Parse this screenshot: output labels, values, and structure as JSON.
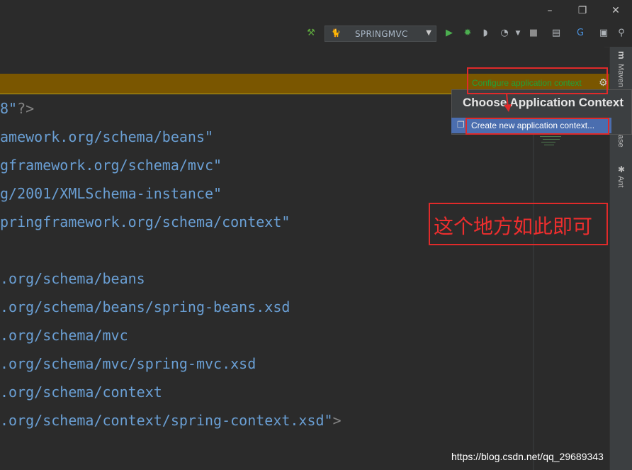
{
  "window": {
    "minimize_glyph": "–",
    "restore_glyph": "❐",
    "close_glyph": "✕"
  },
  "toolbar": {
    "run_config": {
      "label": "SPRINGMVC"
    },
    "icons": [
      "hammer-icon",
      "run-icon",
      "debug-icon",
      "coverage-icon",
      "profiler-icon",
      "stop-icon",
      "project-structure-icon",
      "translate-icon",
      "terminal-icon",
      "search-icon"
    ]
  },
  "editor": {
    "banner": {
      "link_label": "Configure application context"
    },
    "code_lines": [
      {
        "text": "8\"",
        "tail": "?>"
      },
      {
        "text": "amework.org/schema/beans\"",
        "tail": ""
      },
      {
        "text": "gframework.org/schema/mvc\"",
        "tail": ""
      },
      {
        "text": "g/2001/XMLSchema-instance\"",
        "tail": ""
      },
      {
        "text": "pringframework.org/schema/context\"",
        "tail": ""
      },
      {
        "text": "",
        "tail": ""
      },
      {
        "text": ".org/schema/beans",
        "tail": ""
      },
      {
        "text": ".org/schema/beans/spring-beans.xsd",
        "tail": ""
      },
      {
        "text": ".org/schema/mvc",
        "tail": ""
      },
      {
        "text": ".org/schema/mvc/spring-mvc.xsd",
        "tail": ""
      },
      {
        "text": ".org/schema/context",
        "tail": ""
      },
      {
        "text": ".org/schema/context/spring-context.xsd\"",
        "tail": ">"
      }
    ]
  },
  "popup": {
    "title": "Choose Application Context",
    "item_label": "Create new application context..."
  },
  "side_tabs": {
    "maven": "Maven",
    "database": "ase",
    "ant": "Ant"
  },
  "annotation": {
    "text": "这个地方如此即可",
    "color": "#e02a2a"
  },
  "watermark": "https://blog.csdn.net/qq_29689343",
  "colors": {
    "background": "#2b2b2b",
    "banner": "#7a5600",
    "link": "#1ea33c",
    "code": "#6a9fd4",
    "selection": "#4b6eaf"
  }
}
